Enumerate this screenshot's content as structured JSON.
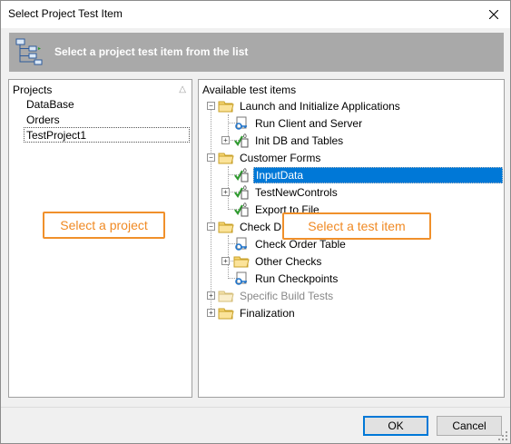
{
  "window": {
    "title": "Select Project Test Item"
  },
  "banner": {
    "text": "Select a project test item from the list"
  },
  "projects": {
    "header": "Projects",
    "items": [
      "DataBase",
      "Orders",
      "TestProject1"
    ],
    "selected": "TestProject1"
  },
  "tests": {
    "header": "Available test items",
    "tree": [
      {
        "label": "Launch and Initialize Applications",
        "icon": "folder-icon"
      },
      {
        "label": "Run Client and Server",
        "icon": "keyword-test-icon"
      },
      {
        "label": "Init DB and Tables",
        "icon": "script-test-icon"
      },
      {
        "label": "Customer Forms",
        "icon": "folder-icon"
      },
      {
        "label": "InputData",
        "icon": "script-test-icon"
      },
      {
        "label": "TestNewControls",
        "icon": "script-test-icon"
      },
      {
        "label": "Export to File",
        "icon": "script-test-icon"
      },
      {
        "label": "Check DB D",
        "icon": "folder-icon"
      },
      {
        "label": "Check Order Table",
        "icon": "keyword-test-icon"
      },
      {
        "label": "Other Checks",
        "icon": "folder-icon"
      },
      {
        "label": "Run Checkpoints",
        "icon": "keyword-test-icon"
      },
      {
        "label": "Specific Build Tests",
        "icon": "folder-icon"
      },
      {
        "label": "Finalization",
        "icon": "folder-icon"
      }
    ]
  },
  "callouts": {
    "project": "Select a project",
    "test_item": "Select a test item"
  },
  "buttons": {
    "ok": "OK",
    "cancel": "Cancel"
  },
  "colors": {
    "accent": "#0078d7",
    "callout": "#f0902b",
    "banner": "#a9a9a9"
  }
}
